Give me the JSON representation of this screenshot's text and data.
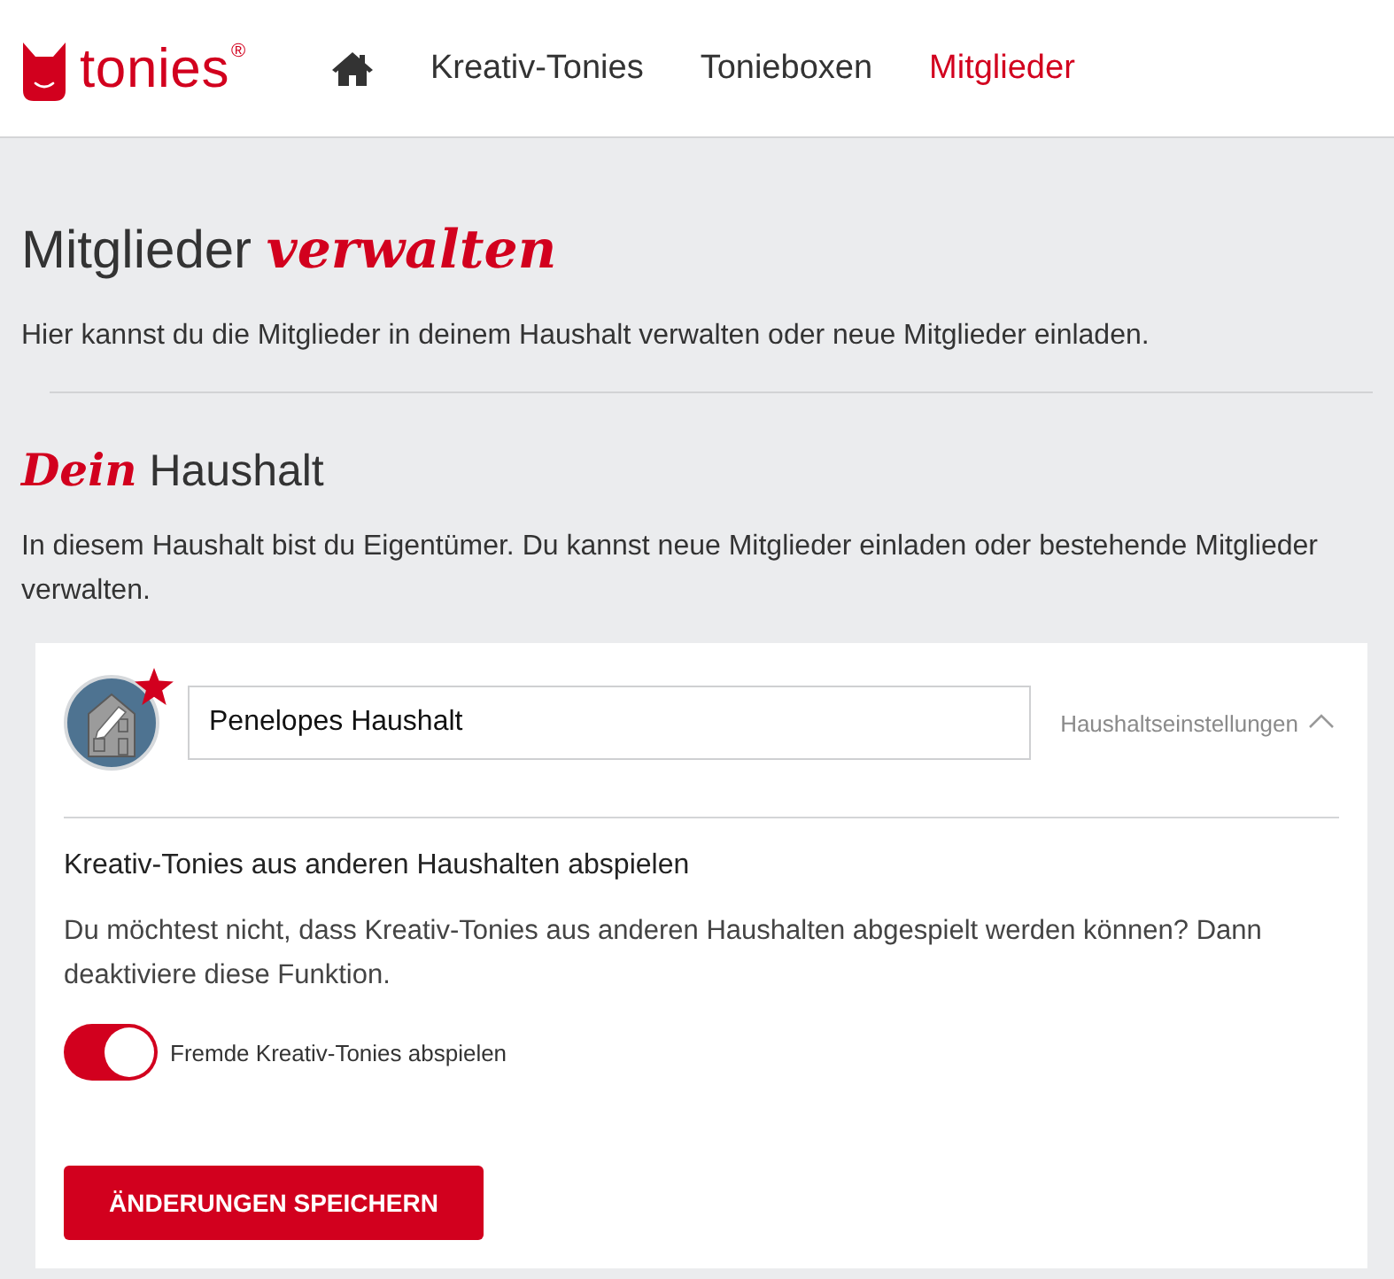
{
  "header": {
    "logo": {
      "wordmark": "tonies$^{®}$"
    },
    "nav": [
      {
        "kind": "home",
        "selected": false
      },
      {
        "kind": "link",
        "label": "Kreativ-Tonies",
        "selected": false
      },
      {
        "kind": "link",
        "label": "Tonieboxen",
        "selected": false
      },
      {
        "kind": "link",
        "label": "Mitglieder",
        "selected": true
      }
    ]
  },
  "page": {
    "title": "Mitglieder *verwalten*",
    "intro": "Hier kannst du die Mitglieder in deinem Haushalt verwalten oder neue Mitglieder einladen."
  },
  "household": {
    "heading": "*Dein* Haushalt",
    "description": "In diesem Haushalt bist du Eigentümer. Du kannst neue Mitglieder einladen oder bestehende Mitglieder verwalten.",
    "card": {
      "owner": true,
      "name_field": {
        "value": "Penelopes Haushalt"
      },
      "settings_link": {
        "label": "Haushaltseinstellungen",
        "expanded": true
      },
      "section": {
        "title": "Kreativ-Tonies aus anderen Haushalten abspielen",
        "description": "Du möchtest nicht, dass Kreativ-Tonies aus anderen Haushalten abgespielt werden können? Dann deaktiviere diese Funktion.",
        "toggle": {
          "label": "Fremde Kreativ-Tonies abspielen",
          "on": true
        }
      },
      "save_button": "ÄNDERUNGEN SPEICHERN"
    }
  }
}
